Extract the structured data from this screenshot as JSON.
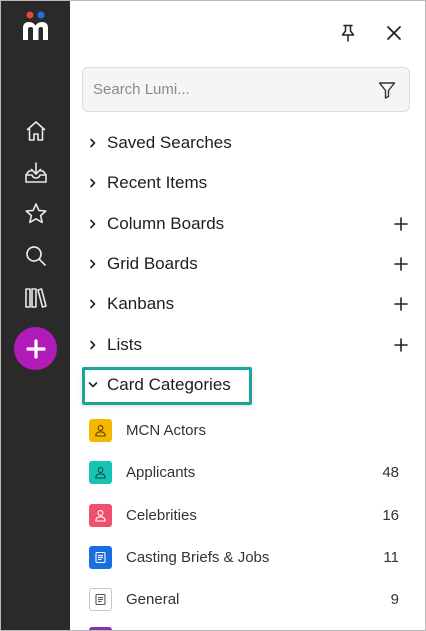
{
  "search": {
    "placeholder": "Search Lumi..."
  },
  "nav_items": [
    {
      "label": "Saved Searches",
      "expanded": false,
      "has_add": false
    },
    {
      "label": "Recent Items",
      "expanded": false,
      "has_add": false
    },
    {
      "label": "Column Boards",
      "expanded": false,
      "has_add": true
    },
    {
      "label": "Grid Boards",
      "expanded": false,
      "has_add": true
    },
    {
      "label": "Kanbans",
      "expanded": false,
      "has_add": true
    },
    {
      "label": "Lists",
      "expanded": false,
      "has_add": true
    },
    {
      "label": "Card Categories",
      "expanded": true,
      "has_add": false
    }
  ],
  "card_categories": [
    {
      "label": "MCN Actors",
      "count": "",
      "icon": "person-icon",
      "color": "#f5b800"
    },
    {
      "label": "Applicants",
      "count": "48",
      "icon": "person-icon",
      "color": "#17c3b2"
    },
    {
      "label": "Celebrities",
      "count": "16",
      "icon": "person-icon",
      "color": "#f0506e"
    },
    {
      "label": "Casting Briefs & Jobs",
      "count": "11",
      "icon": "document-icon",
      "color": "#1a6fe0"
    },
    {
      "label": "General",
      "count": "9",
      "icon": "document-icon",
      "color": "#ffffff"
    }
  ],
  "colors": {
    "rail": "#2a2a2a",
    "add_button": "#b11bb8",
    "highlight_border": "#1aa59c",
    "logo_red": "#e8453c",
    "logo_blue": "#1e6fe8"
  }
}
